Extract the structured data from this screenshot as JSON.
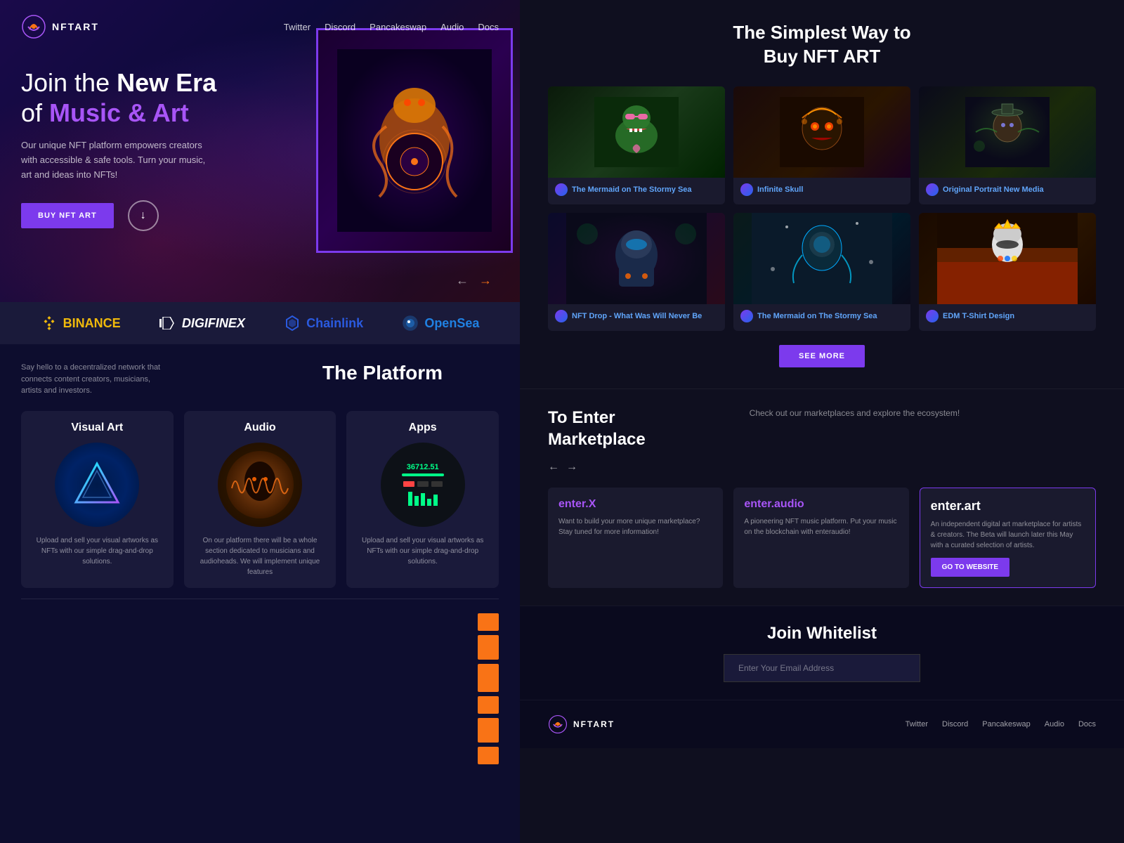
{
  "left": {
    "nav": {
      "logo_text": "NFTART",
      "links": [
        "Twitter",
        "Discord",
        "Pancakeswap",
        "Audio",
        "Docs"
      ]
    },
    "hero": {
      "title_part1": "Join the ",
      "title_bold": "New Era",
      "title_part2": "of ",
      "title_accent": "Music & Art",
      "subtitle": "Our unique NFT platform empowers creators with accessible & safe tools. Turn your music, art and ideas into NFTs!",
      "btn_label": "BUY NFT ART"
    },
    "partners": [
      {
        "name": "BINANCE",
        "class": "binance"
      },
      {
        "name": "DIGIFINEX",
        "class": "digifinex"
      },
      {
        "name": "Chainlink",
        "class": "chainlink"
      },
      {
        "name": "OpenSea",
        "class": "opensea"
      }
    ],
    "platform": {
      "desc": "Say hello to a decentralized network that connects content creators, musicians, artists and investors.",
      "title": "The Platform",
      "cards": [
        {
          "title": "Visual Art",
          "desc": "Upload and sell your visual artworks as NFTs with our simple drag-and-drop solutions."
        },
        {
          "title": "Audio",
          "desc": "On our platform there will be a whole section dedicated to musicians and audioheads. We will implement unique features"
        },
        {
          "title": "Apps",
          "desc": "Upload and sell your visual artworks as NFTs with our simple drag-and-drop solutions."
        }
      ]
    }
  },
  "right": {
    "buy_nft": {
      "title": "The Simplest Way to\nBuy NFT ART",
      "nfts": [
        {
          "name": "The Mermaid on The Stormy Sea",
          "creator": ""
        },
        {
          "name": "Infinite Skull",
          "creator": ""
        },
        {
          "name": "Original Portrait New Media",
          "creator": ""
        },
        {
          "name": "NFT Drop - What Was Will Never Be",
          "creator": ""
        },
        {
          "name": "The Mermaid on The Stormy Sea",
          "creator": ""
        },
        {
          "name": "EDM T-Shirt Design",
          "creator": ""
        }
      ],
      "see_more": "SEE MORE"
    },
    "marketplace": {
      "title": "To Enter\nMarketplace",
      "desc": "Check out our marketplaces and explore the ecosystem!",
      "cards": [
        {
          "id": "enter_x",
          "title": "enter.X",
          "desc": "Want to build your more unique marketplace? Stay tuned for more information!"
        },
        {
          "id": "enter_audio",
          "title": "enter.audio",
          "desc": "A pioneering NFT music platform. Put your music on the blockchain with enteraudio!"
        },
        {
          "id": "enter_art",
          "title": "enter.art",
          "desc": "An independent digital art marketplace for artists & creators. The Beta will launch later this May with a curated selection of artists.",
          "btn": "GO TO WEBSITE"
        }
      ]
    },
    "whitelist": {
      "title": "Join Whitelist",
      "email_placeholder": "Enter Your Email Address"
    },
    "footer": {
      "logo_text": "NFTART",
      "links": [
        "Twitter",
        "Discord",
        "Pancakeswap",
        "Audio",
        "Docs"
      ]
    }
  }
}
